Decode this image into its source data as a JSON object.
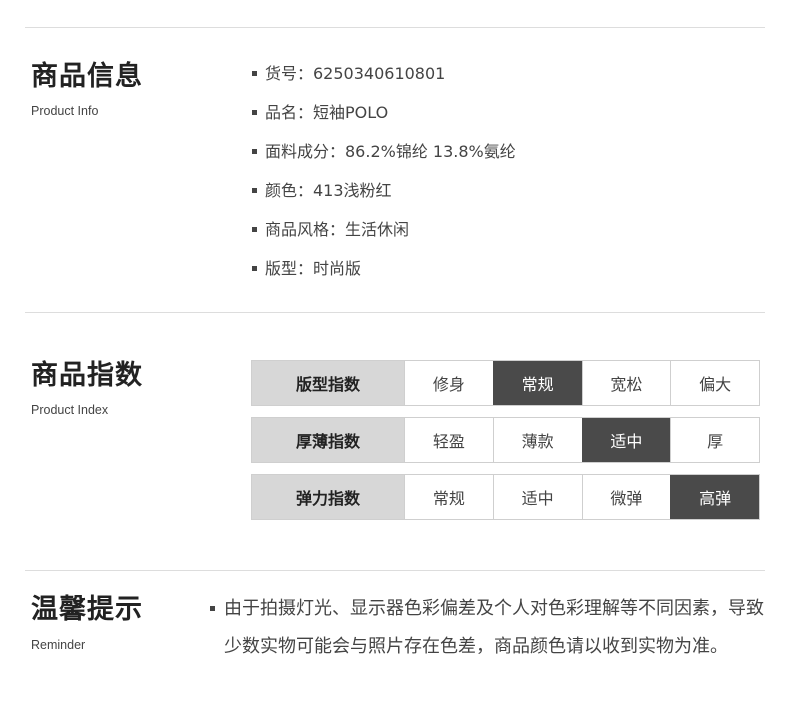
{
  "product_info": {
    "title": "商品信息",
    "subtitle": "Product Info",
    "items": [
      "货号：6250340610801",
      "品名：短袖POLO",
      "面料成分：86.2%锦纶 13.8%氨纶",
      "颜色：413浅粉红",
      "商品风格：生活休闲",
      "版型：时尚版"
    ]
  },
  "product_index": {
    "title": "商品指数",
    "subtitle": "Product Index",
    "rows": [
      {
        "label": "版型指数",
        "options": [
          "修身",
          "常规",
          "宽松",
          "偏大"
        ],
        "selected": "常规"
      },
      {
        "label": "厚薄指数",
        "options": [
          "轻盈",
          "薄款",
          "适中",
          "厚"
        ],
        "selected": "适中"
      },
      {
        "label": "弹力指数",
        "options": [
          "常规",
          "适中",
          "微弹",
          "高弹"
        ],
        "selected": "高弹"
      }
    ]
  },
  "reminder": {
    "title": "温馨提示",
    "subtitle": "Reminder",
    "text": "由于拍摄灯光、显示器色彩偏差及个人对色彩理解等不同因素，导致少数实物可能会与照片存在色差，商品颜色请以收到实物为准。"
  },
  "colors": {
    "selected_bg": "#4a4a4a",
    "label_bg": "#d7d7d7",
    "divider": "#dddddd"
  }
}
